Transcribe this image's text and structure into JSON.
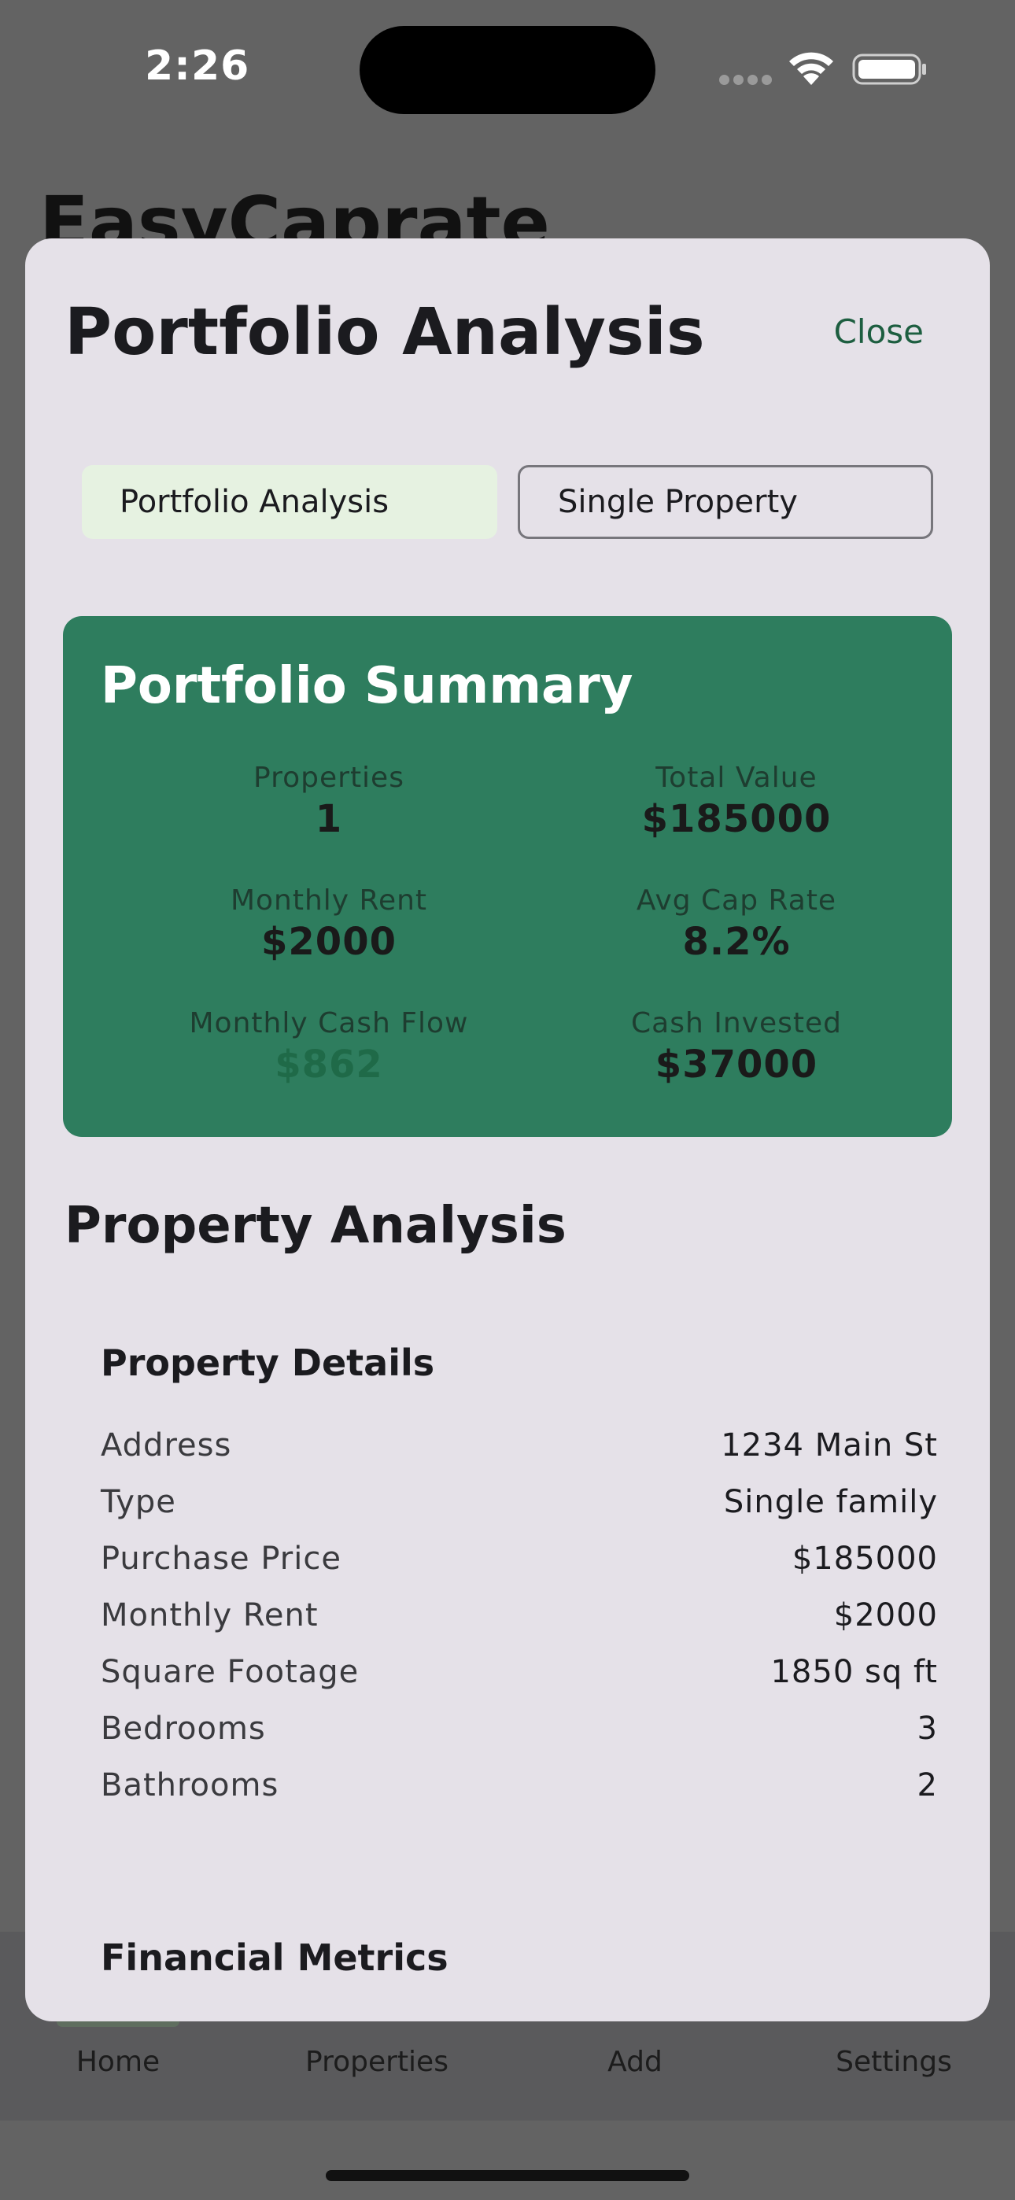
{
  "status_bar": {
    "time": "2:26"
  },
  "background_app": {
    "title": "EasyCaprate",
    "tabs": [
      {
        "label": "Home"
      },
      {
        "label": "Properties"
      },
      {
        "label": "Add"
      },
      {
        "label": "Settings"
      }
    ]
  },
  "sheet": {
    "title": "Portfolio Analysis",
    "close_label": "Close",
    "segments": [
      {
        "label": "Portfolio Analysis",
        "selected": true
      },
      {
        "label": "Single Property",
        "selected": false
      }
    ],
    "summary": {
      "title": "Portfolio Summary",
      "stats": [
        {
          "label": "Properties",
          "value": "1"
        },
        {
          "label": "Total Value",
          "value": "$185000"
        },
        {
          "label": "Monthly Rent",
          "value": "$2000"
        },
        {
          "label": "Avg Cap Rate",
          "value": "8.2%"
        },
        {
          "label": "Monthly Cash Flow",
          "value": "$862"
        },
        {
          "label": "Cash Invested",
          "value": "$37000"
        }
      ]
    },
    "property_analysis": {
      "heading": "Property Analysis",
      "details_heading": "Property Details",
      "details": [
        {
          "label": "Address",
          "value": "1234 Main St"
        },
        {
          "label": "Type",
          "value": "Single family"
        },
        {
          "label": "Purchase Price",
          "value": "$185000"
        },
        {
          "label": "Monthly Rent",
          "value": "$2000"
        },
        {
          "label": "Square Footage",
          "value": "1850 sq ft"
        },
        {
          "label": "Bedrooms",
          "value": "3"
        },
        {
          "label": "Bathrooms",
          "value": "2"
        }
      ],
      "financial_heading": "Financial Metrics"
    }
  },
  "colors": {
    "accent_green": "#2e7d5e",
    "close_text": "#1d5e40",
    "selected_segment": "#e6f2e1",
    "cash_flow_positive": "#1f6a48"
  }
}
